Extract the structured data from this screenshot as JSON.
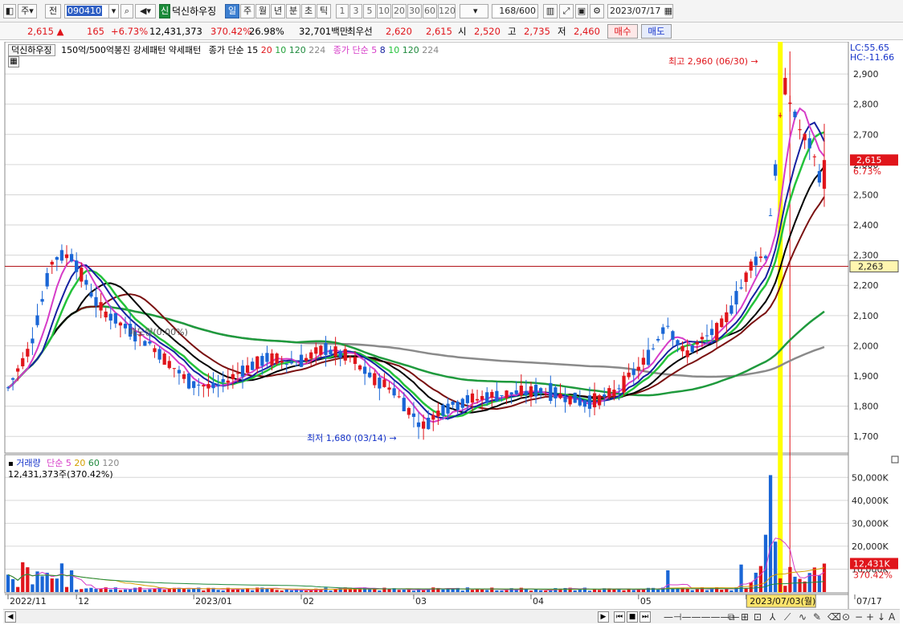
{
  "toolbar": {
    "market_type": "주",
    "chart_kind": "전",
    "code": "090410",
    "badge": "신",
    "stock_name": "덕신하우징",
    "periods": [
      "일",
      "주",
      "월",
      "년",
      "분",
      "초",
      "틱"
    ],
    "active_period": "일",
    "intervals": [
      "1",
      "3",
      "5",
      "10",
      "20",
      "30",
      "60",
      "120"
    ],
    "count_value": "168",
    "count_total": "/600",
    "date": "2023/07/17"
  },
  "quote": {
    "price": "2,615",
    "change_arrow": "▲",
    "change": "165",
    "change_pct": "+6.73%",
    "volume": "12,431,373",
    "volume_ratio": "370.42%",
    "turnover": "26.98%",
    "amount": "32,701백만",
    "priority_label": "최우선",
    "ask": "2,620",
    "bid": "2,615",
    "open_label": "시",
    "open": "2,520",
    "high_label": "고",
    "high": "2,735",
    "low_label": "저",
    "low": "2,460",
    "buy_label": "매수",
    "sell_label": "매도"
  },
  "colors": {
    "up": "#e0151b",
    "down": "#1a66d6",
    "ma5": "#d63cc8",
    "ma8": "#1520a0",
    "ma10": "#23c23a",
    "ma120": "#8a8a8a",
    "ma224": "#1f9a3d",
    "yellow": "#ffff00"
  },
  "legend": {
    "name_box": "덕신하우징",
    "price_pattern": "150억/500억봉진 강세패턴 약세패턴",
    "ma_prefix_1": "종가 단순 15",
    "ma_periods_1": [
      "20",
      "10",
      "120",
      "224"
    ],
    "ma_prefix_2": "종가 단순 5",
    "ma_periods_2": [
      "8",
      "10",
      "120",
      "224"
    ],
    "lc": "LC:55.65",
    "hc": "HC:-11.66",
    "volume_title": "거래량",
    "volume_ma_prefix": "단순 5",
    "volume_ma_periods": [
      "20",
      "60",
      "120"
    ],
    "volume_value": "12,431,373주(370.42%)",
    "min_note": "최저 1,680 (03/14)",
    "max_note": "최고 2,960 (06/30)",
    "trendline_note": "매도량(0.00%)"
  },
  "chart_data": {
    "type": "candlestick",
    "price_axis": [
      "2,900",
      "2,800",
      "2,700",
      "2,600",
      "2,500",
      "2,400",
      "2,300",
      "2,200",
      "2,100",
      "2,000",
      "1,900",
      "1,800",
      "1,700"
    ],
    "price_range": [
      1650,
      2980
    ],
    "current_price_label": "2,615",
    "current_change_label": "6.73%",
    "reference_line": 2263,
    "reference_label": "2,263",
    "volume_axis": [
      "50,000K",
      "40,000K",
      "30,000K",
      "20,000K",
      "10,000K"
    ],
    "volume_range": [
      0,
      55000
    ],
    "current_volume_label": "12,431K",
    "current_volume_pct": "370.42%",
    "x_labels": [
      "2022/11",
      "12",
      "2023/01",
      "02",
      "03",
      "04",
      "05",
      "06",
      "07/17"
    ],
    "x_label_index": [
      0,
      14,
      38,
      60,
      83,
      107,
      129,
      151,
      178
    ],
    "cursor_label": "2023/07/03(월)",
    "bars": 168
  }
}
